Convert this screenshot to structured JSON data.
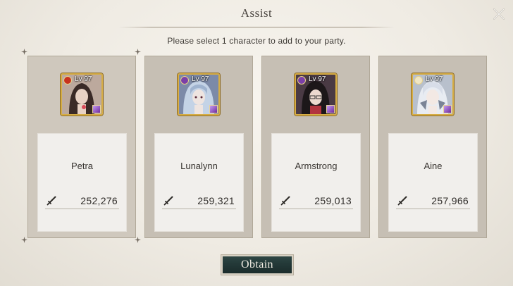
{
  "dialog": {
    "title": "Assist",
    "subtitle": "Please select 1 character to add to your party."
  },
  "characters": [
    {
      "name": "Petra",
      "level_label": "Lv 97",
      "power": "252,276",
      "element_color": "#c8321e",
      "selected": true
    },
    {
      "name": "Lunalynn",
      "level_label": "Lv 97",
      "power": "259,321",
      "element_color": "#7b3fa8",
      "selected": false
    },
    {
      "name": "Armstrong",
      "level_label": "Lv 97",
      "power": "259,013",
      "element_color": "#7b3fa8",
      "selected": false
    },
    {
      "name": "Aine",
      "level_label": "Lv 97",
      "power": "257,966",
      "element_color": "#f0e6c4",
      "selected": false
    }
  ],
  "buttons": {
    "obtain": "Obtain"
  },
  "icons": {
    "close": "close-icon",
    "power": "sword-icon",
    "element": "element-icon",
    "rarity": "gem-icon"
  }
}
